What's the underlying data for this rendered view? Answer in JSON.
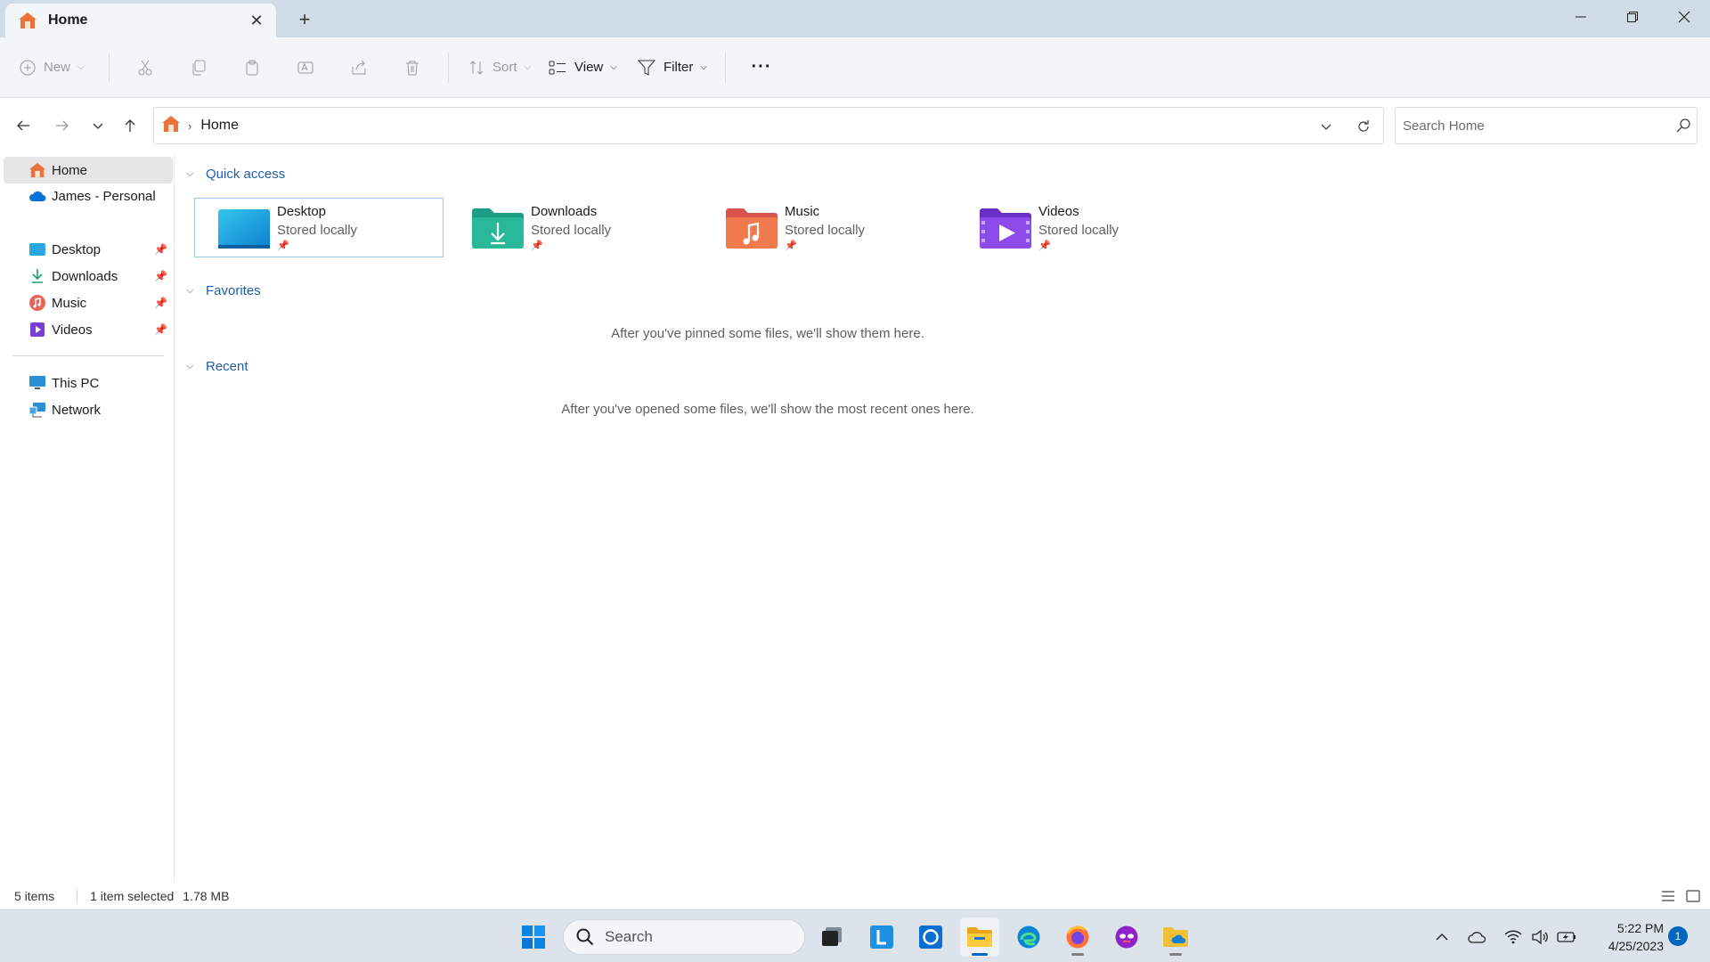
{
  "window": {
    "tab_title": "Home",
    "tab_close_glyph": "✕",
    "new_tab_glyph": "+",
    "controls": [
      "minimize-icon",
      "restore-icon",
      "close-icon"
    ]
  },
  "commandbar": {
    "new_label": "New",
    "sort_label": "Sort",
    "view_label": "View",
    "filter_label": "Filter",
    "more_glyph": "···",
    "icons": [
      "cut-icon",
      "copy-icon",
      "paste-icon",
      "rename-icon",
      "share-icon",
      "delete-icon"
    ]
  },
  "address": {
    "crumb_sep": "›",
    "crumb": "Home"
  },
  "search": {
    "placeholder": "Search Home"
  },
  "sidebar": {
    "home": "Home",
    "onedrive": "James - Personal",
    "pinned": [
      {
        "label": "Desktop",
        "icon": "desktop-icon"
      },
      {
        "label": "Downloads",
        "icon": "downloads-icon"
      },
      {
        "label": "Music",
        "icon": "music-icon"
      },
      {
        "label": "Videos",
        "icon": "videos-icon"
      }
    ],
    "this_pc": "This PC",
    "network": "Network"
  },
  "main": {
    "quick_access": {
      "header": "Quick access",
      "tiles": [
        {
          "name": "Desktop",
          "sub": "Stored locally",
          "icon": "desktop-folder-icon"
        },
        {
          "name": "Downloads",
          "sub": "Stored locally",
          "icon": "downloads-folder-icon"
        },
        {
          "name": "Music",
          "sub": "Stored locally",
          "icon": "music-folder-icon"
        },
        {
          "name": "Videos",
          "sub": "Stored locally",
          "icon": "videos-folder-icon"
        }
      ]
    },
    "favorites": {
      "header": "Favorites",
      "empty": "After you've pinned some files, we'll show them here."
    },
    "recent": {
      "header": "Recent",
      "empty": "After you've opened some files, we'll show the most recent ones here."
    }
  },
  "status": {
    "items": "5 items",
    "selected": "1 item selected",
    "size": "1.78 MB"
  },
  "taskbar": {
    "search_label": "Search",
    "apps": [
      "start-icon",
      "task-view-icon",
      "l-app-icon",
      "cortana-icon",
      "file-explorer-icon",
      "edge-icon",
      "firefox-icon",
      "mask-app-icon",
      "onedrive-folder-icon"
    ],
    "time": "5:22 PM",
    "date": "4/25/2023",
    "notifications": "1"
  },
  "colors": {
    "accent": "#0067c0",
    "titlebar": "#cfdbe6",
    "link": "#1f5fa8"
  }
}
